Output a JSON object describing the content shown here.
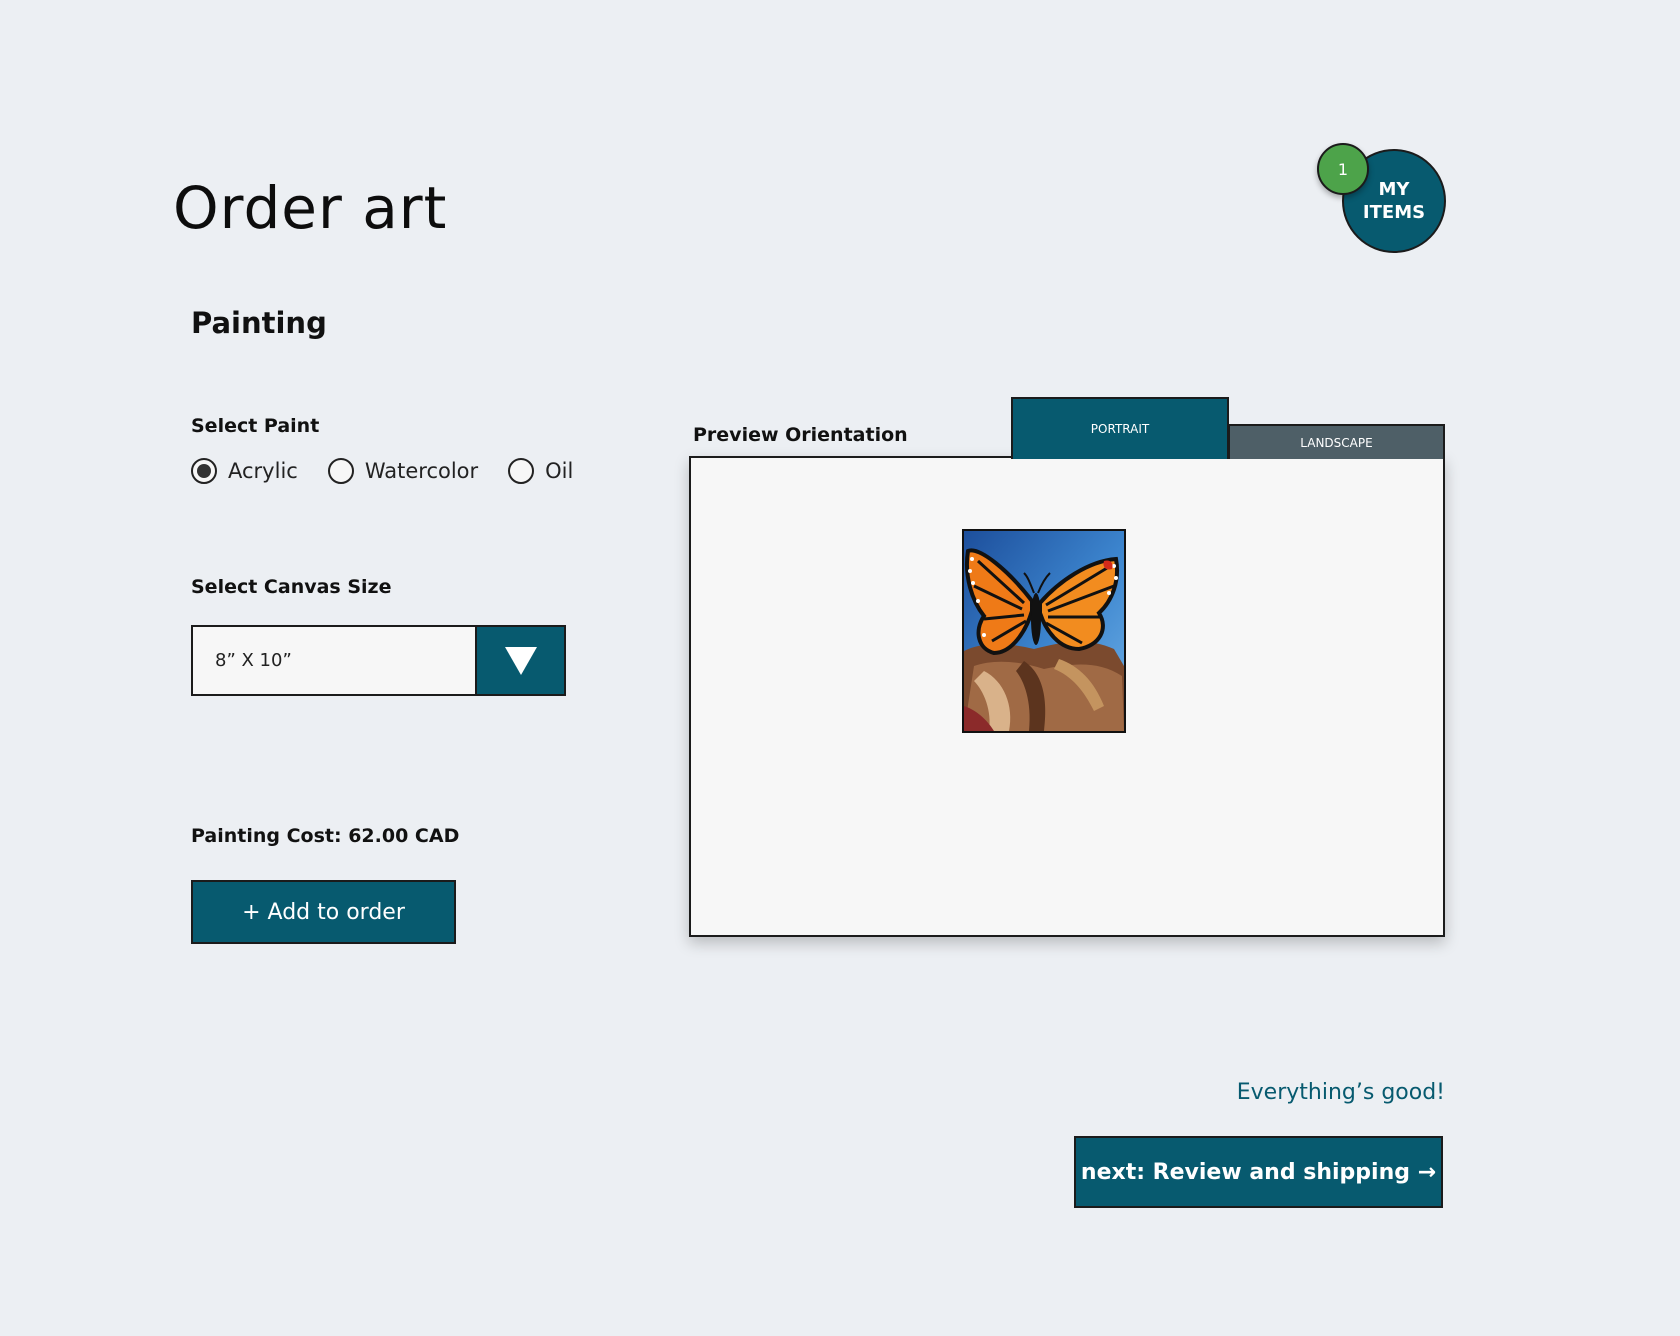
{
  "header": {
    "title": "Order art",
    "cart": {
      "label_line1": "MY",
      "label_line2": "ITEMS",
      "count": "1"
    }
  },
  "section": {
    "title": "Painting"
  },
  "paint": {
    "label": "Select Paint",
    "options": [
      "Acrylic",
      "Watercolor",
      "Oil"
    ],
    "selected": "Acrylic"
  },
  "canvas": {
    "label": "Select Canvas Size",
    "selected": "8” X 10”"
  },
  "cost": {
    "text": "Painting Cost: 62.00 CAD"
  },
  "add_button": {
    "label": "+ Add to order"
  },
  "preview": {
    "label": "Preview Orientation",
    "tabs": [
      {
        "label": "PORTRAIT",
        "active": true
      },
      {
        "label": "LANDSCAPE",
        "active": false
      }
    ]
  },
  "footer": {
    "status": "Everything’s good!",
    "next_label": "next: Review and shipping →"
  },
  "colors": {
    "primary": "#075a6f",
    "badge": "#4da34a",
    "inactive_tab": "#4e5f67",
    "background": "#eceff3"
  }
}
